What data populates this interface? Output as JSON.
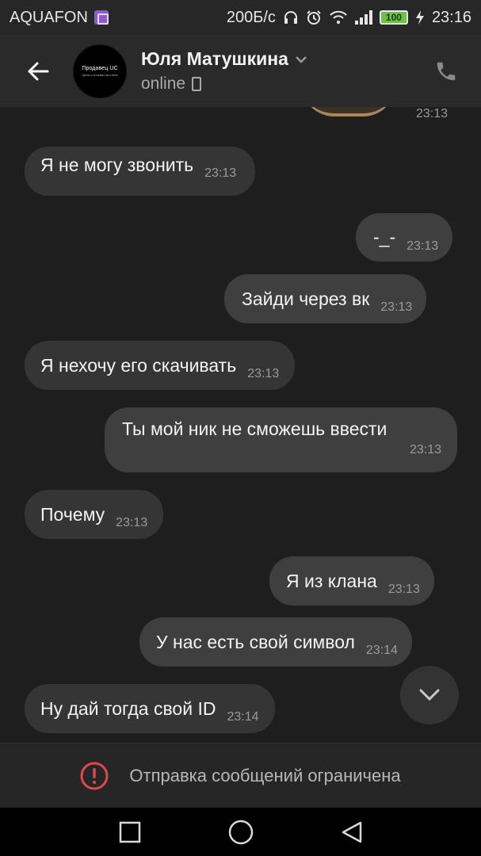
{
  "status_bar": {
    "carrier": "AQUAFON",
    "speed": "200Б/с",
    "battery": "100",
    "time": "23:16"
  },
  "header": {
    "contact_name": "Юля Матушкина",
    "presence": "online",
    "avatar": {
      "title": "Продавец UC",
      "subtitle": "Цены и отзывы на стене"
    }
  },
  "chat": {
    "sticker_time": "23:13",
    "messages": [
      {
        "direction": "incoming",
        "text": "Я не могу звонить",
        "time": "23:13"
      },
      {
        "direction": "outgoing",
        "text": "-_-",
        "time": "23:13"
      },
      {
        "direction": "outgoing",
        "text": "Зайди через вк",
        "time": "23:13"
      },
      {
        "direction": "incoming",
        "text": "Я нехочу его скачивать",
        "time": "23:13"
      },
      {
        "direction": "outgoing",
        "text": "Ты мой ник не сможешь ввести",
        "time": "23:13"
      },
      {
        "direction": "incoming",
        "text": "Почему",
        "time": "23:13"
      },
      {
        "direction": "outgoing",
        "text": "Я из клана",
        "time": "23:13"
      },
      {
        "direction": "outgoing",
        "text": "У нас есть свой символ",
        "time": "23:14"
      },
      {
        "direction": "incoming",
        "text": "Ну дай тогда свой ID",
        "time": "23:14"
      }
    ]
  },
  "restricted_bar": {
    "text": "Отправка сообщений ограничена"
  },
  "colors": {
    "background": "#1e1e1e",
    "header": "#2a2a2a",
    "bubble": "#3c3c3c",
    "alert_red": "#e0484f"
  }
}
